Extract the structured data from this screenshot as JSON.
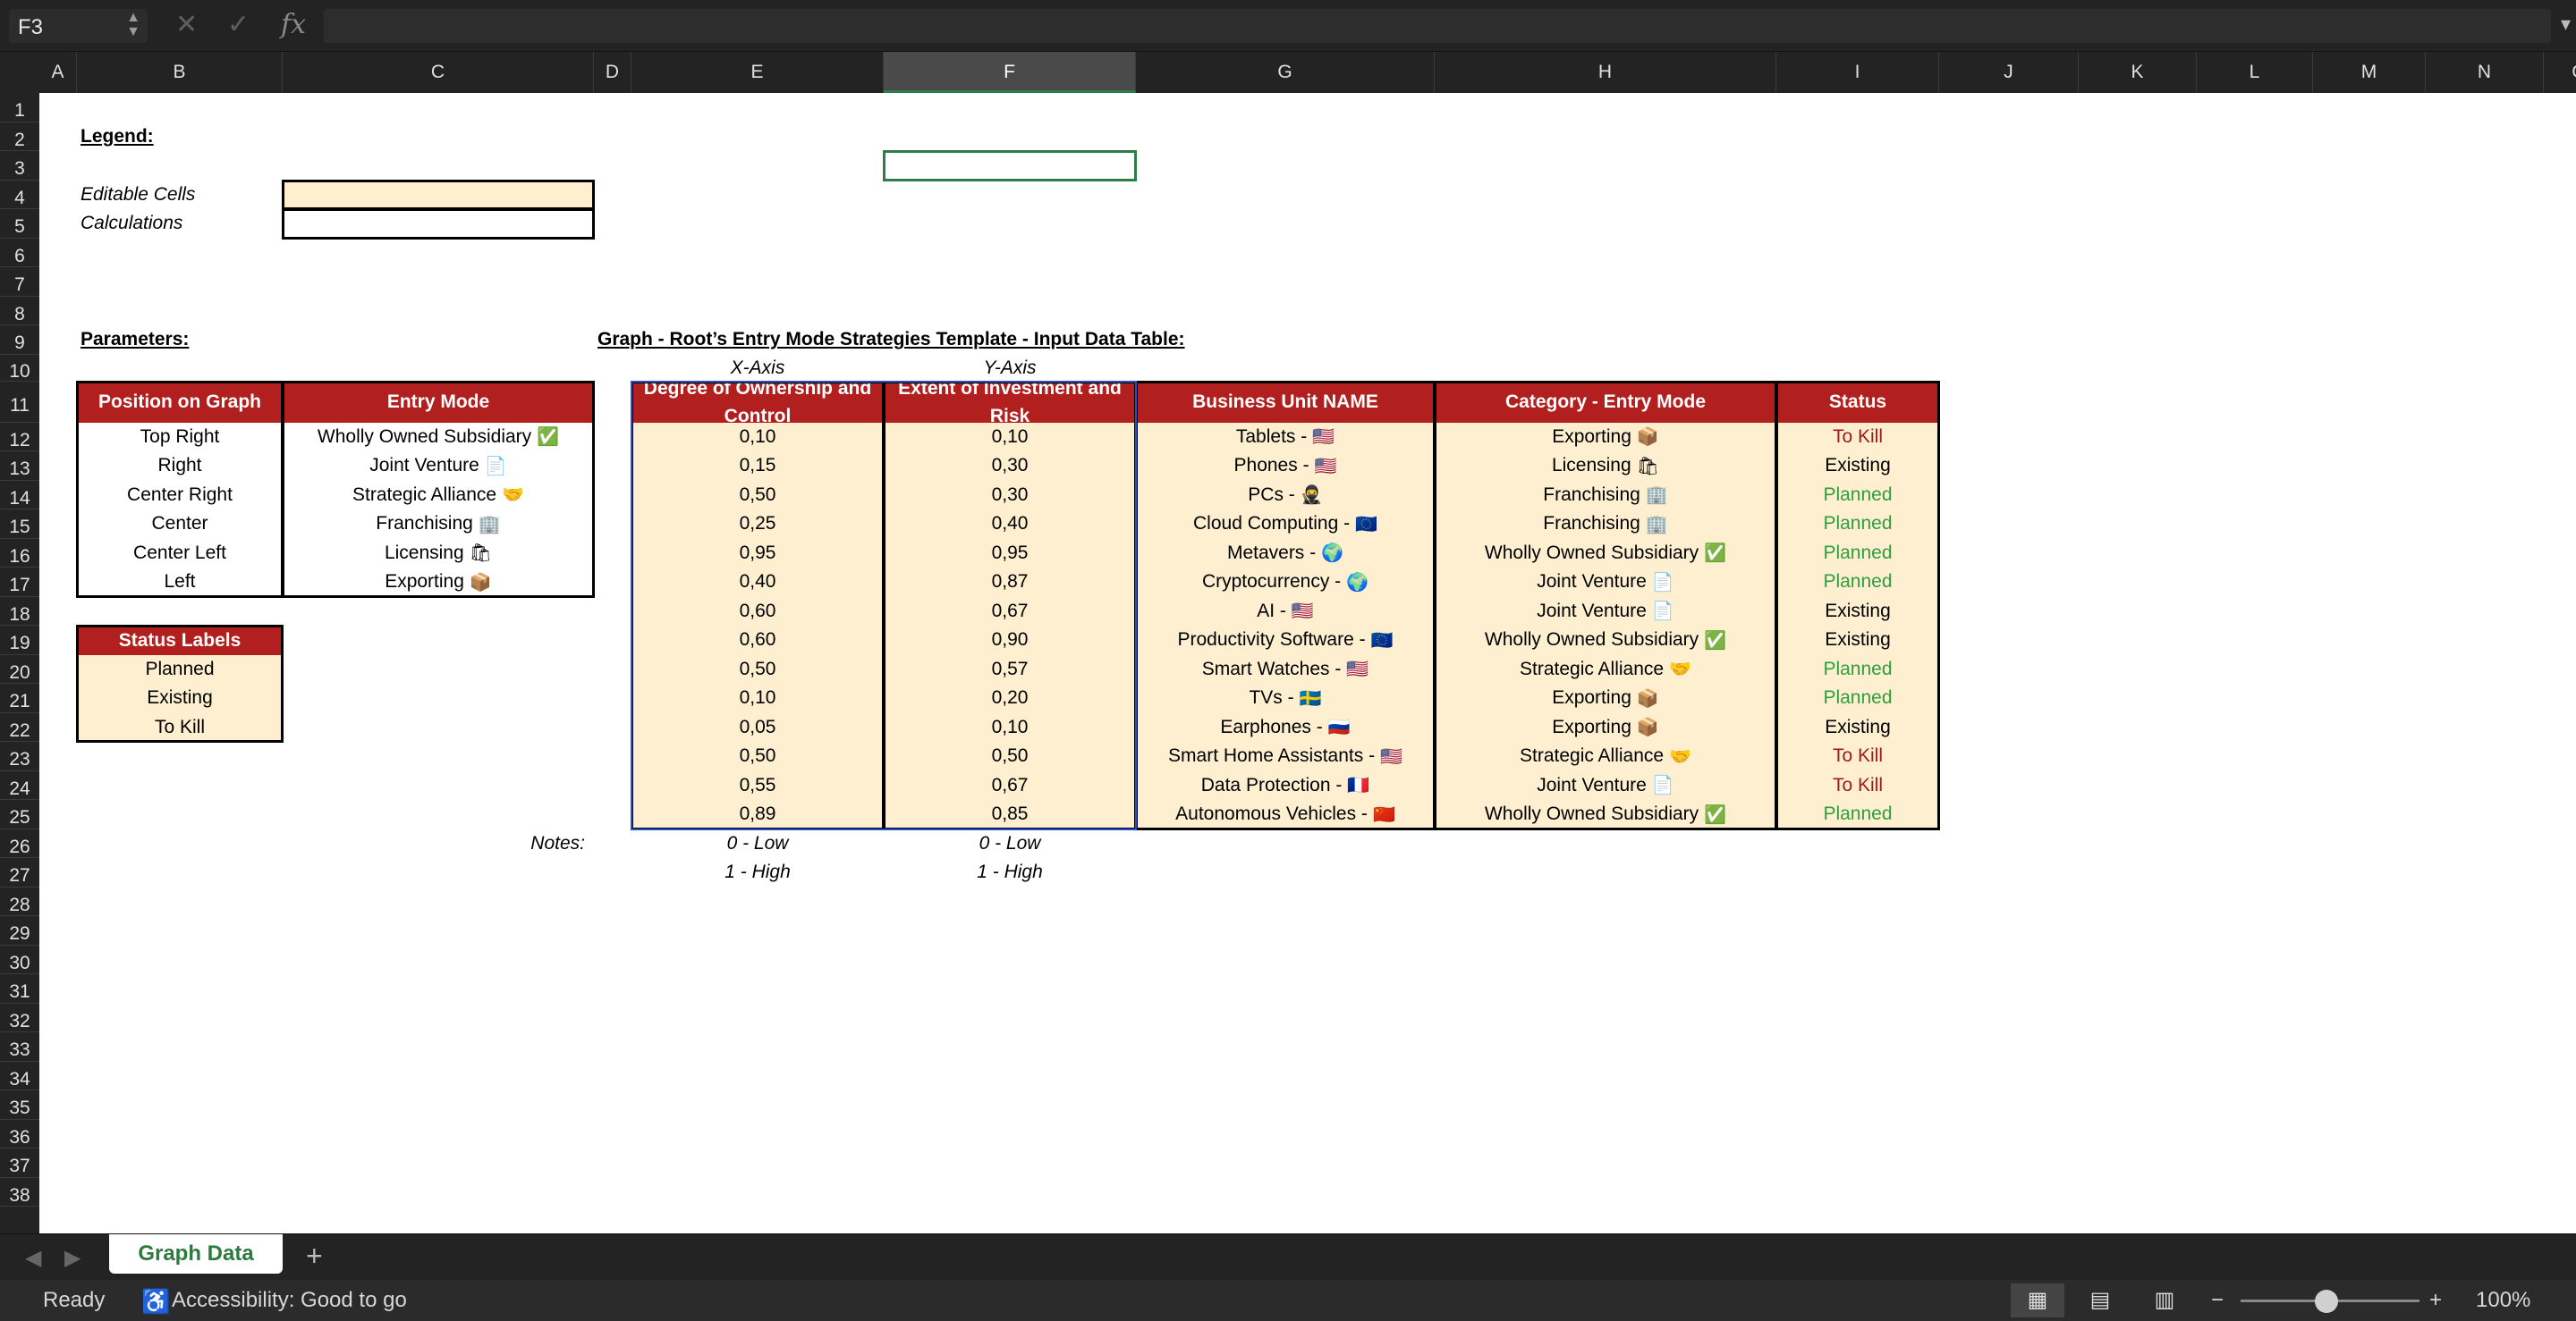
{
  "formula_bar": {
    "name_box": "F3",
    "cancel_icon": "✕",
    "enter_icon": "✓",
    "fx_label": "fx",
    "formula_value": ""
  },
  "columns": [
    "A",
    "B",
    "C",
    "D",
    "E",
    "F",
    "G",
    "H",
    "I",
    "J",
    "K",
    "L",
    "M",
    "N",
    "O"
  ],
  "selected_column": "F",
  "rows": [
    "1",
    "2",
    "3",
    "4",
    "5",
    "6",
    "7",
    "8",
    "9",
    "10",
    "11",
    "12",
    "13",
    "14",
    "15",
    "16",
    "17",
    "18",
    "19",
    "20",
    "21",
    "22",
    "23",
    "24",
    "25",
    "26",
    "27",
    "28",
    "29",
    "30",
    "31",
    "32",
    "33",
    "34",
    "35",
    "36",
    "37",
    "38"
  ],
  "legend": {
    "title": "Legend:",
    "editable": "Editable Cells",
    "calculations": "Calculations"
  },
  "parameters": {
    "title": "Parameters:",
    "headers": [
      "Position on Graph",
      "Entry Mode"
    ],
    "rows": [
      {
        "position": "Top Right",
        "mode": "Wholly Owned Subsidiary",
        "icon": "✅"
      },
      {
        "position": "Right",
        "mode": "Joint Venture",
        "icon": "📄"
      },
      {
        "position": "Center Right",
        "mode": "Strategic Alliance",
        "icon": "🤝"
      },
      {
        "position": "Center",
        "mode": "Franchising",
        "icon": "🏢"
      },
      {
        "position": "Center Left",
        "mode": "Licensing",
        "icon": "🛍"
      },
      {
        "position": "Left",
        "mode": "Exporting",
        "icon": "📦"
      }
    ]
  },
  "status_labels": {
    "title": "Status Labels",
    "items": [
      "Planned",
      "Existing",
      "To Kill"
    ]
  },
  "input_table": {
    "title": "Graph - Root’s Entry Mode Strategies Template - Input Data Table:",
    "x_axis_label": "X-Axis",
    "y_axis_label": "Y-Axis",
    "headers": [
      "Degree of Ownership and Control",
      "Extent of Investment and Risk",
      "Business Unit NAME",
      "Category - Entry Mode",
      "Status"
    ],
    "rows": [
      {
        "x": "0,10",
        "y": "0,10",
        "unit": "Tablets - ",
        "unit_icon": "🇺🇸",
        "category": "Exporting",
        "cat_icon": "📦",
        "status": "To Kill"
      },
      {
        "x": "0,15",
        "y": "0,30",
        "unit": "Phones - ",
        "unit_icon": "🇺🇸",
        "category": "Licensing",
        "cat_icon": "🛍",
        "status": "Existing"
      },
      {
        "x": "0,50",
        "y": "0,30",
        "unit": "PCs - ",
        "unit_icon": "🥷",
        "category": "Franchising",
        "cat_icon": "🏢",
        "status": "Planned"
      },
      {
        "x": "0,25",
        "y": "0,40",
        "unit": "Cloud Computing - ",
        "unit_icon": "🇪🇺",
        "category": "Franchising",
        "cat_icon": "🏢",
        "status": "Planned"
      },
      {
        "x": "0,95",
        "y": "0,95",
        "unit": "Metavers - ",
        "unit_icon": "🌍",
        "category": "Wholly Owned Subsidiary",
        "cat_icon": "✅",
        "status": "Planned"
      },
      {
        "x": "0,40",
        "y": "0,87",
        "unit": "Cryptocurrency - ",
        "unit_icon": "🌍",
        "category": "Joint Venture",
        "cat_icon": "📄",
        "status": "Planned"
      },
      {
        "x": "0,60",
        "y": "0,67",
        "unit": "AI - ",
        "unit_icon": "🇺🇸",
        "category": "Joint Venture",
        "cat_icon": "📄",
        "status": "Existing"
      },
      {
        "x": "0,60",
        "y": "0,90",
        "unit": "Productivity Software - ",
        "unit_icon": "🇪🇺",
        "category": "Wholly Owned Subsidiary",
        "cat_icon": "✅",
        "status": "Existing"
      },
      {
        "x": "0,50",
        "y": "0,57",
        "unit": "Smart Watches - ",
        "unit_icon": "🇺🇸",
        "category": "Strategic Alliance",
        "cat_icon": "🤝",
        "status": "Planned"
      },
      {
        "x": "0,10",
        "y": "0,20",
        "unit": "TVs - ",
        "unit_icon": "🇸🇪",
        "category": "Exporting",
        "cat_icon": "📦",
        "status": "Planned"
      },
      {
        "x": "0,05",
        "y": "0,10",
        "unit": "Earphones - ",
        "unit_icon": "🇷🇺",
        "category": "Exporting",
        "cat_icon": "📦",
        "status": "Existing"
      },
      {
        "x": "0,50",
        "y": "0,50",
        "unit": "Smart Home Assistants - ",
        "unit_icon": "🇺🇸",
        "category": "Strategic Alliance",
        "cat_icon": "🤝",
        "status": "To Kill"
      },
      {
        "x": "0,55",
        "y": "0,67",
        "unit": "Data Protection - ",
        "unit_icon": "🇫🇷",
        "category": "Joint Venture",
        "cat_icon": "📄",
        "status": "To Kill"
      },
      {
        "x": "0,89",
        "y": "0,85",
        "unit": "Autonomous Vehicles - ",
        "unit_icon": "🇨🇳",
        "category": "Wholly Owned Subsidiary",
        "cat_icon": "✅",
        "status": "Planned"
      }
    ],
    "notes_label": "Notes:",
    "notes": [
      "0 - Low",
      "1 - High"
    ]
  },
  "tabs": {
    "active": "Graph Data",
    "add": "+"
  },
  "status_bar": {
    "ready": "Ready",
    "accessibility": "Accessibility: Good to go",
    "zoom": "100%",
    "zoom_minus": "−",
    "zoom_plus": "+"
  },
  "colors": {
    "header_red": "#b11f1f",
    "cream": "#fdefd0",
    "planned_green": "#2e9e3e",
    "kill_red": "#a31818",
    "selection_green": "#2f7d46",
    "selection_blue": "#2450c8"
  }
}
